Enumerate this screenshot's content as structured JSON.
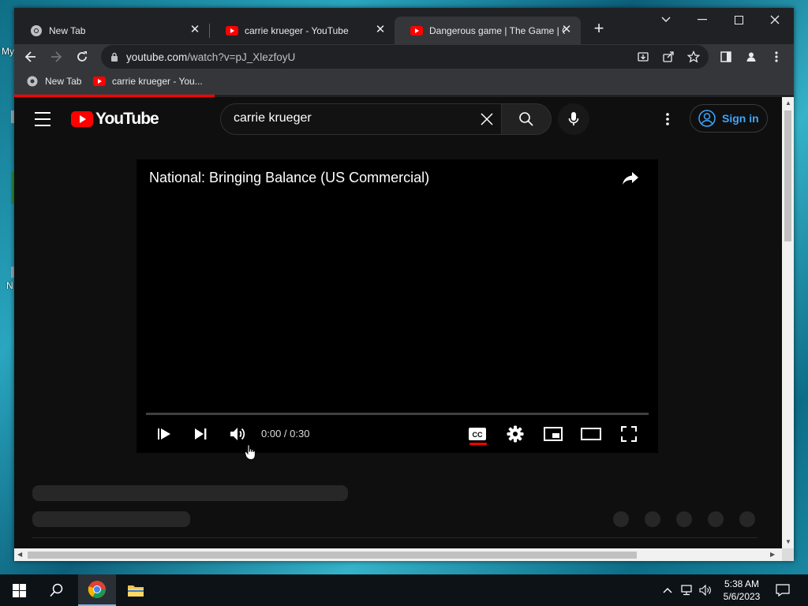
{
  "desktop": {
    "label_my": "My",
    "label_n": "N"
  },
  "browser": {
    "tabs": [
      {
        "title": "New Tab",
        "active": false,
        "icon": "chrome-icon"
      },
      {
        "title": "carrie krueger - YouTube",
        "active": false,
        "icon": "youtube-icon"
      },
      {
        "title": "Dangerous game | The Game | G",
        "active": true,
        "icon": "youtube-icon"
      }
    ],
    "url_host": "youtube.com",
    "url_path": "/watch?v=pJ_XlezfoyU",
    "bookmarks": [
      {
        "label": "New Tab",
        "icon": "globe-icon"
      },
      {
        "label": "carrie krueger - You...",
        "icon": "youtube-icon"
      }
    ]
  },
  "youtube": {
    "logo_text": "YouTube",
    "search_value": "carrie krueger",
    "sign_in": "Sign in",
    "player": {
      "title": "National: Bringing Balance (US Commercial)",
      "time": "0:00 / 0:30",
      "progress": 0
    }
  },
  "taskbar": {
    "time": "5:38 AM",
    "date": "5/6/2023"
  },
  "colors": {
    "accent_red": "#ff0000",
    "link_blue": "#3ea6ff",
    "page_bg": "#0f0f0f"
  }
}
